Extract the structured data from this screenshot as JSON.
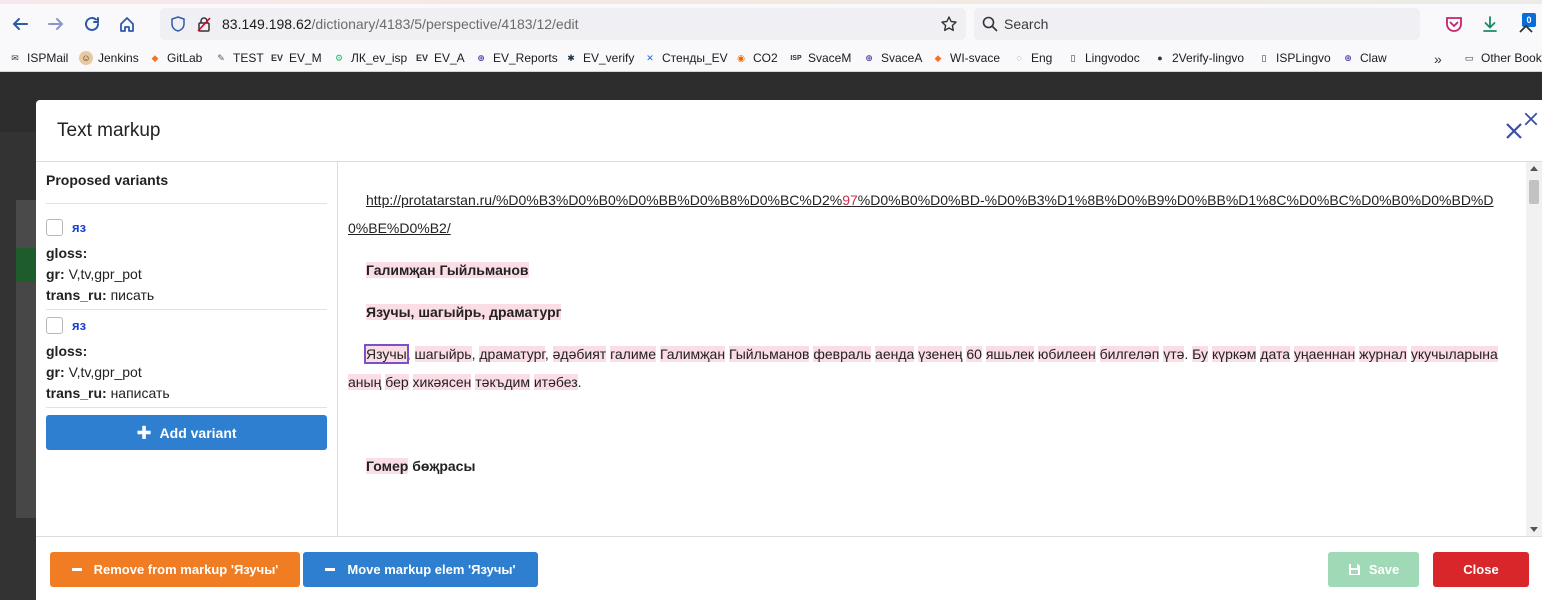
{
  "browser": {
    "url_host": "83.149.198.62",
    "url_path": "/dictionary/4183/5/perspective/4183/12/edit",
    "search_placeholder": "Search",
    "downloads_badge": "0",
    "bookmarks": [
      {
        "label": "ISPMail",
        "icon": "ispmail-icon"
      },
      {
        "label": "Jenkins",
        "icon": "jenkins-icon"
      },
      {
        "label": "GitLab",
        "icon": "gitlab-icon"
      },
      {
        "label": "TEST",
        "icon": "test-icon"
      },
      {
        "label": "EV_M",
        "icon": "ev-icon"
      },
      {
        "label": "ЛК_ev_isp",
        "icon": "lk-icon"
      },
      {
        "label": "EV_A",
        "icon": "ev-icon"
      },
      {
        "label": "EV_Reports",
        "icon": "globe-icon"
      },
      {
        "label": "EV_verify",
        "icon": "verify-icon"
      },
      {
        "label": "Стенды_EV",
        "icon": "confluence-icon"
      },
      {
        "label": "CO2",
        "icon": "grafana-icon"
      },
      {
        "label": "SvaceM",
        "icon": "isp-ras-icon"
      },
      {
        "label": "SvaceA",
        "icon": "globe-icon"
      },
      {
        "label": "WI-svace",
        "icon": "gitlab-icon"
      },
      {
        "label": "Eng",
        "icon": "eng-icon"
      },
      {
        "label": "Lingvodoc",
        "icon": "doc-icon"
      },
      {
        "label": "2Verify-lingvo",
        "icon": "github-icon"
      },
      {
        "label": "ISPLingvo",
        "icon": "doc-icon"
      },
      {
        "label": "Claw",
        "icon": "globe-icon"
      }
    ],
    "other_bookmarks": "Other Book"
  },
  "modal": {
    "title": "Text markup",
    "left": {
      "title": "Proposed variants",
      "variants": [
        {
          "word": "яз",
          "gloss_label": "gloss:",
          "gloss_value": "",
          "gr_label": "gr:",
          "gr_value": "V,tv,gpr_pot",
          "trans_label": "trans_ru:",
          "trans_value": "писать"
        },
        {
          "word": "яз",
          "gloss_label": "gloss:",
          "gloss_value": "",
          "gr_label": "gr:",
          "gr_value": "V,tv,gpr_pot",
          "trans_label": "trans_ru:",
          "trans_value": "написать"
        }
      ],
      "add_variant_label": "Add variant"
    },
    "right": {
      "link_before": "http://protatarstan.ru/%D0%B3%D0%B0%D0%BB%D0%B8%D0%BC%D2%",
      "link_highlight": "97",
      "link_after": "%D0%B0%D0%BD-%D0%B3%D1%8B%D0%B9%D0%BB%D1%8C%D0%BC%D0%B0%D0%BD%D0%BE%D0%B2/",
      "heading1": "Галимҗан Гыйльманов",
      "heading2_marked": "Язучы",
      "heading2_rest": ", шагыйрь, драматург",
      "paragraph": {
        "selected_word": "Язучы",
        "after_selected": ", ",
        "words": [
          "шагыйрь",
          ", ",
          "драматург",
          ", ",
          "әдәбият",
          " ",
          "галиме",
          " ",
          "Галимҗан",
          " ",
          "Гыйльманов",
          " ",
          "февраль",
          " ",
          "аенда",
          " ",
          "үзенең",
          " ",
          "60",
          " ",
          "яшьлек",
          " ",
          "юбилеен",
          " ",
          "билгеләп",
          " ",
          "үтә",
          ". ",
          "Бу",
          " ",
          "күркәм",
          " ",
          "дата",
          " ",
          "уңаеннан",
          " ",
          "журнал",
          " ",
          "укучыларына",
          " ",
          "аның",
          " ",
          "бер",
          " ",
          "хикәясен",
          " ",
          "тәкъдим",
          " ",
          "итәбез",
          "."
        ]
      },
      "heading3_marked": "Гомер",
      "heading3_rest": " бөҗрасы"
    },
    "footer": {
      "remove_label": "Remove from markup 'Язучы'",
      "move_label": "Move markup elem 'Язучы'",
      "save_label": "Save",
      "close_label": "Close"
    }
  }
}
